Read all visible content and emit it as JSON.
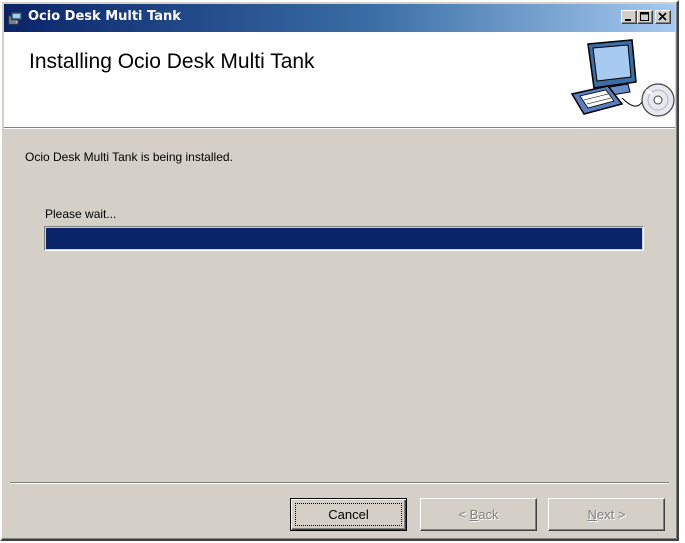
{
  "window": {
    "title": "Ocio Desk Multi Tank"
  },
  "header": {
    "title": "Installing Ocio Desk Multi Tank",
    "graphic_icon": "computer-with-cd-icon"
  },
  "main": {
    "status_text": "Ocio Desk Multi Tank is being installed.",
    "wait_text": "Please wait...",
    "progress_fraction": 1.0
  },
  "buttons": {
    "cancel": {
      "label": "Cancel",
      "enabled": true
    },
    "back": {
      "mnemonic": "B",
      "rest": "ack",
      "prefix": "< ",
      "enabled": false
    },
    "next": {
      "mnemonic": "N",
      "rest": "ext >",
      "enabled": false
    }
  },
  "colors": {
    "titlebar_start": "#0a246a",
    "progress_fill": "#0a246a",
    "face": "#d4d0c8"
  }
}
